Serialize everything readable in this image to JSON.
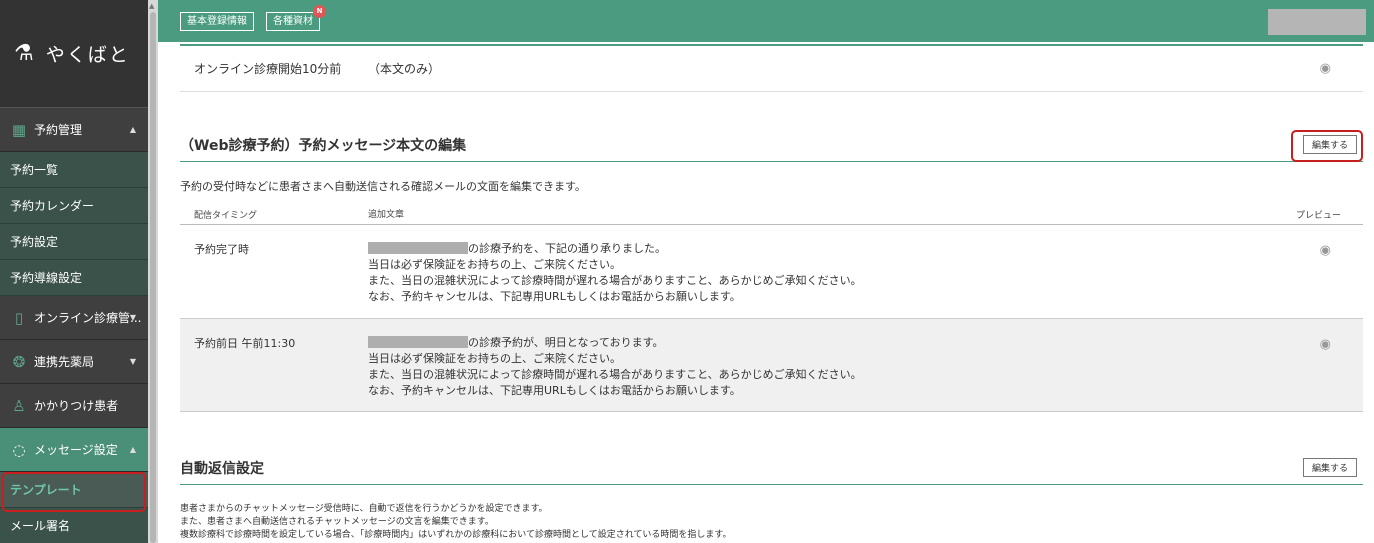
{
  "sidebar": {
    "logo": "やくばと",
    "items": [
      {
        "type": "cat",
        "icon": "calendar-icon",
        "label": "予約管理",
        "caret": "▲"
      },
      {
        "type": "sub",
        "label": "予約一覧"
      },
      {
        "type": "sub",
        "label": "予約カレンダー"
      },
      {
        "type": "sub",
        "label": "予約設定"
      },
      {
        "type": "sub",
        "label": "予約導線設定"
      },
      {
        "type": "cat",
        "icon": "smartphone-icon",
        "label": "オンライン診療管...",
        "caret": "▼"
      },
      {
        "type": "cat",
        "icon": "pharmacy-icon",
        "label": "連携先薬局",
        "caret": "▼"
      },
      {
        "type": "cat",
        "icon": "person-icon",
        "label": "かかりつけ患者",
        "caret": ""
      },
      {
        "type": "cat",
        "icon": "chat-icon",
        "label": "メッセージ設定",
        "caret": "▲"
      },
      {
        "type": "sub",
        "label": "テンプレート"
      },
      {
        "type": "sub",
        "label": "メール署名"
      }
    ]
  },
  "topbar": {
    "btn1": "基本登録情報",
    "btn2": "各種資材",
    "badge": "N"
  },
  "top_row": {
    "timing": "オンライン診療開始10分前",
    "text": "（本文のみ）"
  },
  "web_section": {
    "title": "（Web診療予約）予約メッセージ本文の編集",
    "edit_label": "編集する",
    "desc": "予約の受付時などに患者さまへ自動送信される確認メールの文面を編集できます。",
    "col_timing": "配信タイミング",
    "col_text": "追加文章",
    "col_preview": "プレビュー",
    "rows": [
      {
        "timing": "予約完了時",
        "line1": "の診療予約を、下記の通り承りました。",
        "line2": "当日は必ず保険証をお持ちの上、ご来院ください。",
        "line3": "また、当日の混雑状況によって診療時間が遅れる場合がありますこと、あらかじめご承知ください。",
        "line4": "なお、予約キャンセルは、下記専用URLもしくはお電話からお願いします。"
      },
      {
        "timing": "予約前日 午前11:30",
        "line1": "の診療予約が、明日となっております。",
        "line2": "当日は必ず保険証をお持ちの上、ご来院ください。",
        "line3": "また、当日の混雑状況によって診療時間が遅れる場合がありますこと、あらかじめご承知ください。",
        "line4": "なお、予約キャンセルは、下記専用URLもしくはお電話からお願いします。"
      }
    ]
  },
  "auto_section": {
    "title": "自動返信設定",
    "edit_label": "編集する",
    "desc1": "患者さまからのチャットメッセージ受信時に、自動で返信を行うかどうかを設定できます。",
    "desc2": "また、患者さまへ自動送信されるチャットメッセージの文言を編集できます。",
    "desc3": "複数診療科で診療時間を設定している場合、「診療時間内」はいずれかの診療科において診療時間として設定されている時間を指します。"
  }
}
